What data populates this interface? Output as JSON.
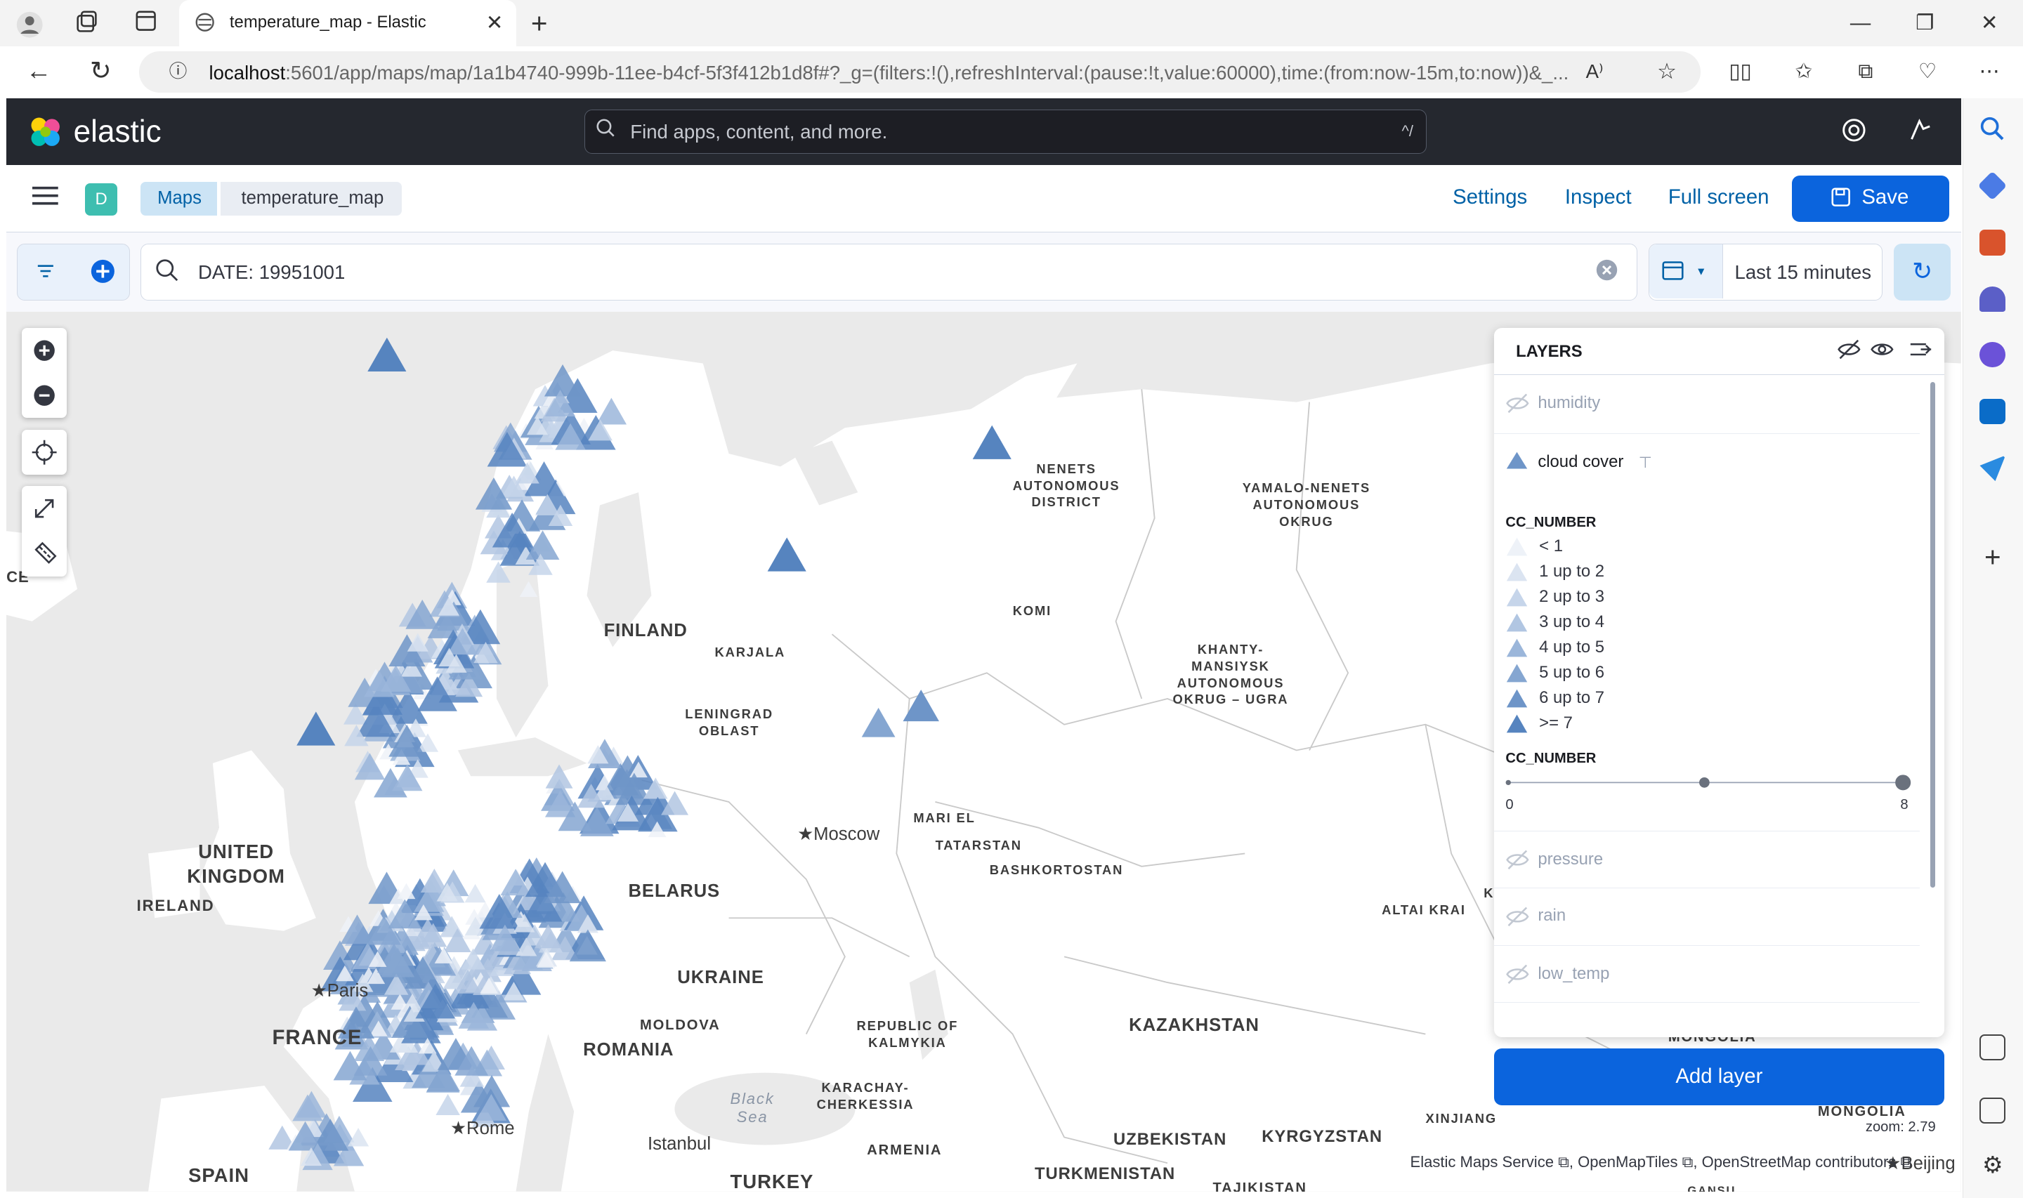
{
  "browser": {
    "tab_title": "temperature_map - Elastic",
    "url_host": "localhost",
    "url_rest": ":5601/app/maps/map/1a1b4740-999b-11ee-b4cf-5f3f412b1d8f#?_g=(filters:!(),refreshInterval:(pause:!t,value:60000),time:(from:now-15m,to:now))&_..."
  },
  "header": {
    "logo_text": "elastic",
    "search_placeholder": "Find apps, content, and more.",
    "search_shortcut": "^/"
  },
  "subheader": {
    "space_badge": "D",
    "breadcrumbs": [
      "Maps",
      "temperature_map"
    ],
    "links": [
      "Settings",
      "Inspect",
      "Full screen"
    ],
    "save_label": "Save"
  },
  "query": {
    "text": "DATE: 19951001",
    "time_range": "Last 15 minutes"
  },
  "map": {
    "labels": {
      "finland": "FINLAND",
      "karjala": "KARJALA",
      "leningrad": "LENINGRAD\nOBLAST",
      "nenets": "NENETS\nAUTONOMOUS\nDISTRICT",
      "yamalo": "YAMALO-NENETS\nAUTONOMOUS\nOKRUG",
      "komi": "KOMI",
      "khanty": "KHANTY-\nMANSIYSK\nAUTONOMOUS\nOKRUG – UGRA",
      "mari": "MARI EL",
      "tatarstan": "TATARSTAN",
      "bashkortostan": "BASHKORTOSTAN",
      "moscow": "★Moscow",
      "uk": "UNITED\nKINGDOM",
      "ireland": "IRELAND",
      "belarus": "BELARUS",
      "ukraine": "UKRAINE",
      "moldova": "MOLDOVA",
      "romania": "ROMANIA",
      "kalmykia": "REPUBLIC OF\nKALMYKIA",
      "kazakhstan": "KAZAKHSTAN",
      "karachay": "KARACHAY-\nCHERKESSIA",
      "armenia": "ARMENIA",
      "uzbekistan": "UZBEKISTAN",
      "kyrgyzstan": "KYRGYZSTAN",
      "turkmenistan": "TURKMENISTAN",
      "tajikistan": "TAJIKISTAN",
      "xinjiang": "XINJIANG",
      "mongolia": "MONGOLIA",
      "mongolia2": "MONGOLIA",
      "altai": "ALTAI KRAI",
      "france": "FRANCE",
      "paris": "★Paris",
      "rome": "★Rome",
      "istanbul": "Istanbul",
      "turkey": "TURKEY",
      "spain": "SPAIN",
      "black_sea": "Black\nSea",
      "beijing": "★Beijing",
      "ce": "CE",
      "gansu": "GANSU",
      "k_partial": "K"
    },
    "zoom_text": "zoom: 2.79",
    "attribution": [
      "Elastic Maps Service",
      "OpenMapTiles",
      "OpenStreetMap contributors"
    ]
  },
  "layers_panel": {
    "title": "LAYERS",
    "layers": [
      {
        "name": "humidity",
        "visible": false
      },
      {
        "name": "cloud cover",
        "visible": true
      },
      {
        "name": "pressure",
        "visible": false
      },
      {
        "name": "rain",
        "visible": false
      },
      {
        "name": "low_temp",
        "visible": false
      }
    ],
    "legend": {
      "color_title": "CC_NUMBER",
      "color_items": [
        "< 1",
        "1 up to 2",
        "2 up to 3",
        "3 up to 4",
        "4 up to 5",
        "5 up to 6",
        "6 up to 7",
        ">= 7"
      ],
      "color_steps": [
        "#eef2f8",
        "#dbe4f1",
        "#c6d5ea",
        "#b1c6e2",
        "#9bb6da",
        "#85a6d1",
        "#6e95c8",
        "#5684bf"
      ],
      "size_title": "CC_NUMBER",
      "size_min": "0",
      "size_max": "8"
    },
    "add_layer_label": "Add layer"
  }
}
